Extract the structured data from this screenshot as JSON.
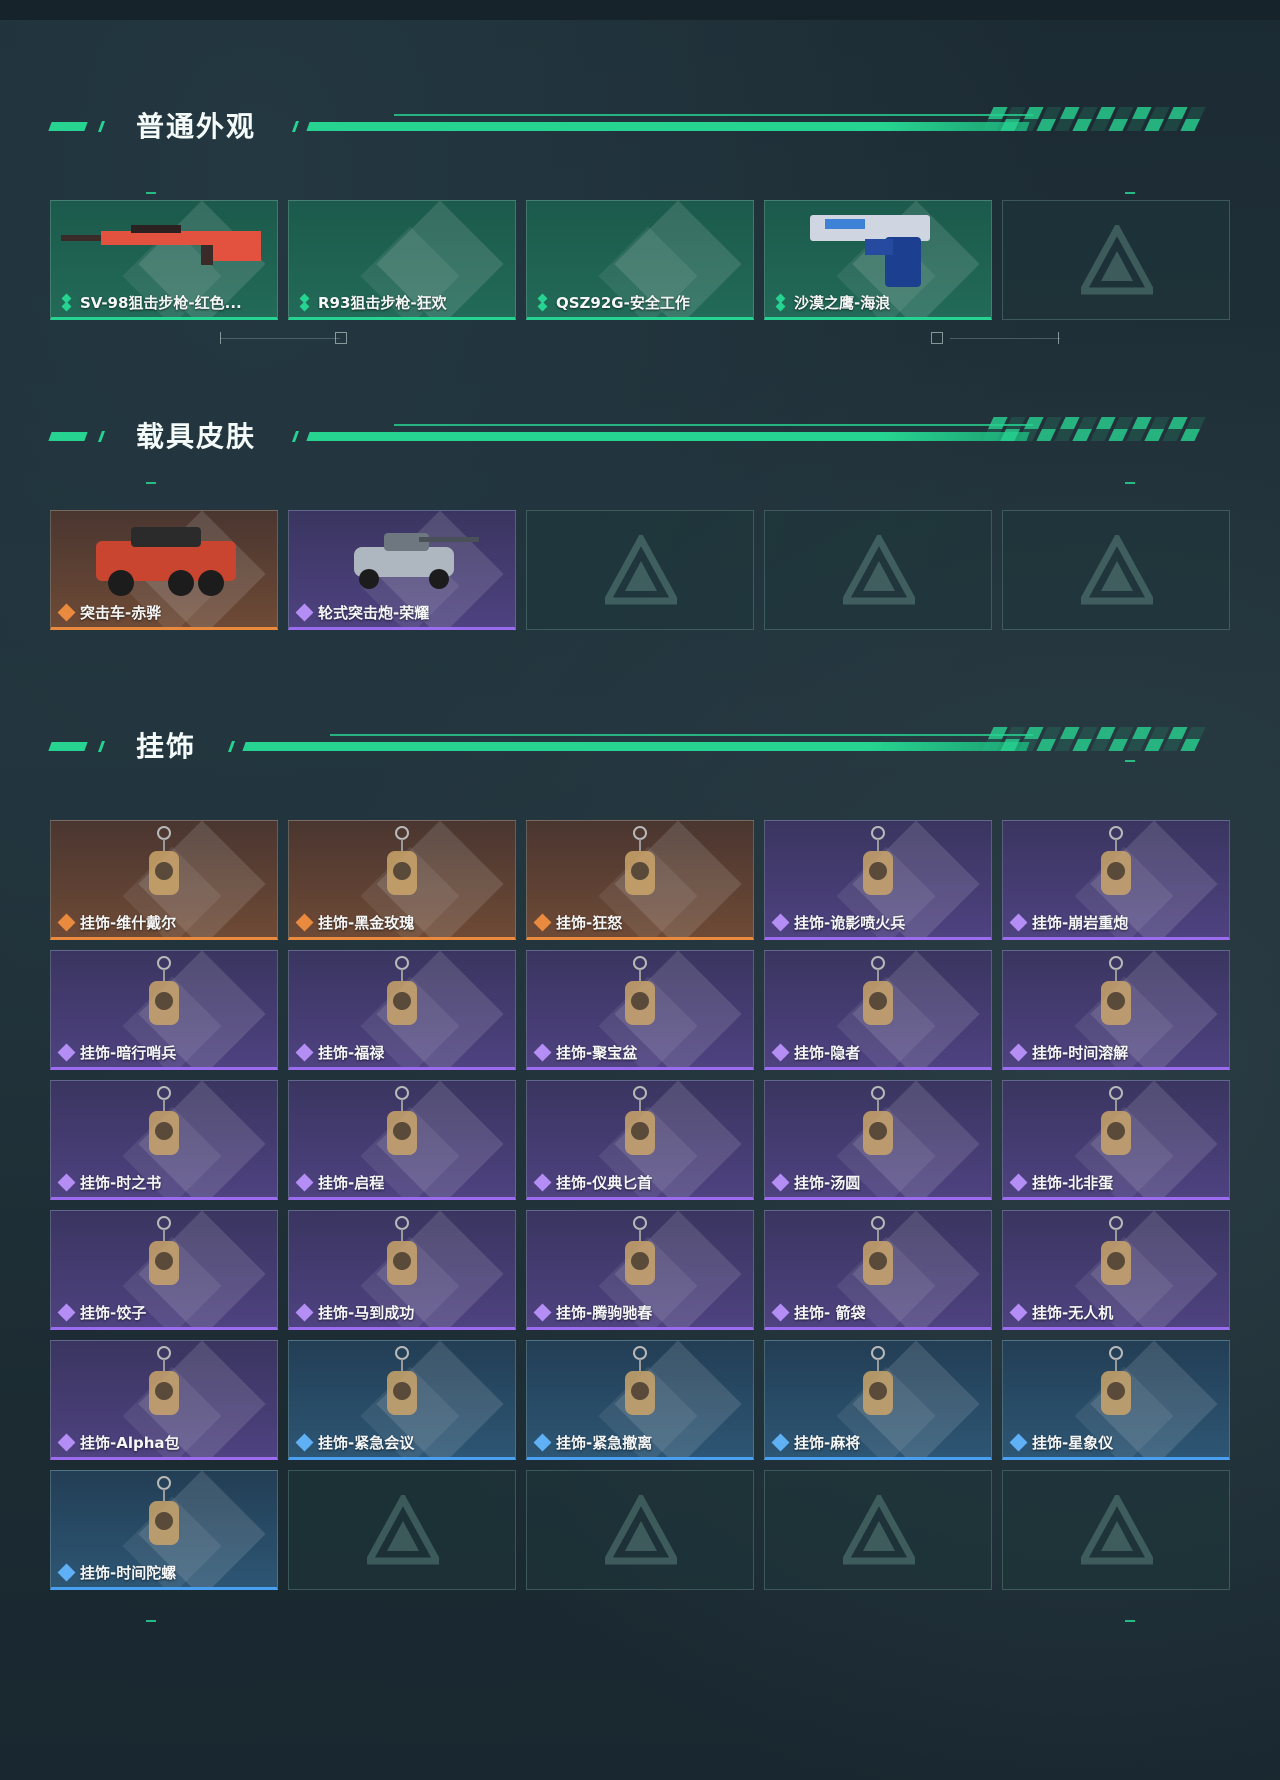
{
  "sections": [
    {
      "title": "普通外观",
      "items": [
        {
          "label": "SV-98狙击步枪-红色...",
          "rarity": "green",
          "icon": "sniper-rifle-red"
        },
        {
          "label": "R93狙击步枪-狂欢",
          "rarity": "green",
          "icon": ""
        },
        {
          "label": "QSZ92G-安全工作",
          "rarity": "green",
          "icon": ""
        },
        {
          "label": "沙漠之鹰-海浪",
          "rarity": "green",
          "icon": "desert-eagle-pistol"
        },
        {
          "label": "",
          "rarity": "empty",
          "icon": "logo-placeholder"
        }
      ]
    },
    {
      "title": "载具皮肤",
      "items": [
        {
          "label": "突击车-赤骅",
          "rarity": "orange",
          "icon": "assault-vehicle"
        },
        {
          "label": "轮式突击炮-荣耀",
          "rarity": "purple",
          "icon": "wheeled-assault-gun"
        },
        {
          "label": "",
          "rarity": "empty",
          "icon": "logo-placeholder"
        },
        {
          "label": "",
          "rarity": "empty",
          "icon": "logo-placeholder"
        },
        {
          "label": "",
          "rarity": "empty",
          "icon": "logo-placeholder"
        }
      ]
    },
    {
      "title": "挂饰",
      "items": [
        {
          "label": "挂饰-维什戴尔",
          "rarity": "orange",
          "icon": "charm"
        },
        {
          "label": "挂饰-黑金玫瑰",
          "rarity": "orange",
          "icon": "charm"
        },
        {
          "label": "挂饰-狂怒",
          "rarity": "orange",
          "icon": "charm"
        },
        {
          "label": "挂饰-诡影喷火兵",
          "rarity": "purple",
          "icon": "charm"
        },
        {
          "label": "挂饰-崩岩重炮",
          "rarity": "purple",
          "icon": "charm"
        },
        {
          "label": "挂饰-暗行哨兵",
          "rarity": "purple",
          "icon": "charm"
        },
        {
          "label": "挂饰-福禄",
          "rarity": "purple",
          "icon": "charm"
        },
        {
          "label": "挂饰-聚宝盆",
          "rarity": "purple",
          "icon": "charm"
        },
        {
          "label": "挂饰-隐者",
          "rarity": "purple",
          "icon": "charm"
        },
        {
          "label": "挂饰-时间溶解",
          "rarity": "purple",
          "icon": "charm"
        },
        {
          "label": "挂饰-时之书",
          "rarity": "purple",
          "icon": "charm"
        },
        {
          "label": "挂饰-启程",
          "rarity": "purple",
          "icon": "charm"
        },
        {
          "label": "挂饰-仪典匕首",
          "rarity": "purple",
          "icon": "charm"
        },
        {
          "label": "挂饰-汤圆",
          "rarity": "purple",
          "icon": "charm"
        },
        {
          "label": "挂饰-北非蛋",
          "rarity": "purple",
          "icon": "charm"
        },
        {
          "label": "挂饰-饺子",
          "rarity": "purple",
          "icon": "charm"
        },
        {
          "label": "挂饰-马到成功",
          "rarity": "purple",
          "icon": "charm"
        },
        {
          "label": "挂饰-腾驹驰春",
          "rarity": "purple",
          "icon": "charm"
        },
        {
          "label": "挂饰- 箭袋",
          "rarity": "purple",
          "icon": "charm"
        },
        {
          "label": "挂饰-无人机",
          "rarity": "purple",
          "icon": "charm"
        },
        {
          "label": "挂饰-Alpha包",
          "rarity": "purple",
          "icon": "charm"
        },
        {
          "label": "挂饰-紧急会议",
          "rarity": "blue",
          "icon": "charm"
        },
        {
          "label": "挂饰-紧急撤离",
          "rarity": "blue",
          "icon": "charm"
        },
        {
          "label": "挂饰-麻将",
          "rarity": "blue",
          "icon": "charm"
        },
        {
          "label": "挂饰-星象仪",
          "rarity": "blue",
          "icon": "charm"
        },
        {
          "label": "挂饰-时间陀螺",
          "rarity": "blue",
          "icon": "charm"
        },
        {
          "label": "",
          "rarity": "empty",
          "icon": "logo-placeholder"
        },
        {
          "label": "",
          "rarity": "empty",
          "icon": "logo-placeholder"
        },
        {
          "label": "",
          "rarity": "empty",
          "icon": "logo-placeholder"
        },
        {
          "label": "",
          "rarity": "empty",
          "icon": "logo-placeholder"
        }
      ]
    }
  ],
  "colors": {
    "accent": "#27d391",
    "orange": "#e98a3e",
    "purple": "#9b6cf0",
    "blue": "#4aa0f0",
    "green": "#27d391"
  }
}
